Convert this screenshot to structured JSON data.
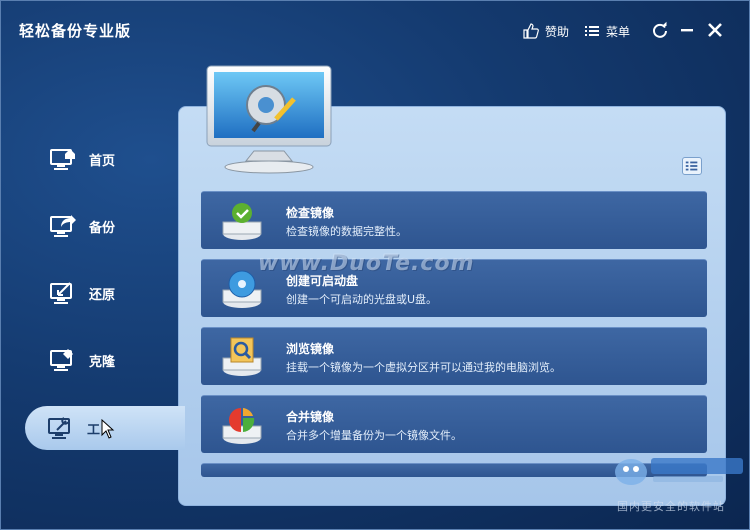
{
  "app": {
    "title": "轻松备份专业版"
  },
  "titlebar": {
    "like_label": "赞助",
    "menu_label": "菜单",
    "like_icon": "thumbs-up-icon",
    "menu_icon": "list-icon",
    "refresh_icon": "refresh-icon",
    "minimize_icon": "minimize-icon",
    "close_icon": "close-icon"
  },
  "sidebar": {
    "items": [
      {
        "label": "首页",
        "icon": "home-monitor-icon"
      },
      {
        "label": "备份",
        "icon": "backup-monitor-icon"
      },
      {
        "label": "还原",
        "icon": "restore-monitor-icon"
      },
      {
        "label": "克隆",
        "icon": "clone-monitor-icon"
      },
      {
        "label": "工",
        "icon": "tools-monitor-icon",
        "active": true
      }
    ]
  },
  "tools": [
    {
      "title": "检查镜像",
      "desc": "检查镜像的数据完整性。",
      "icon": "check-image-icon"
    },
    {
      "title": "创建可启动盘",
      "desc": "创建一个可启动的光盘或U盘。",
      "icon": "bootable-disc-icon"
    },
    {
      "title": "浏览镜像",
      "desc": "挂载一个镜像为一个虚拟分区并可以通过我的电脑浏览。",
      "icon": "explore-image-icon"
    },
    {
      "title": "合并镜像",
      "desc": "合并多个增量备份为一个镜像文件。",
      "icon": "merge-image-icon"
    }
  ],
  "watermark": {
    "text": "www.DuoTe.com"
  },
  "site": {
    "slogan": "国内更安全的软件站"
  },
  "colors": {
    "window_bg": "#143a6f",
    "panel_bg": "#b5d2f0",
    "row_bg": "#3a62a0",
    "active_nav": "#bcd7f2"
  }
}
